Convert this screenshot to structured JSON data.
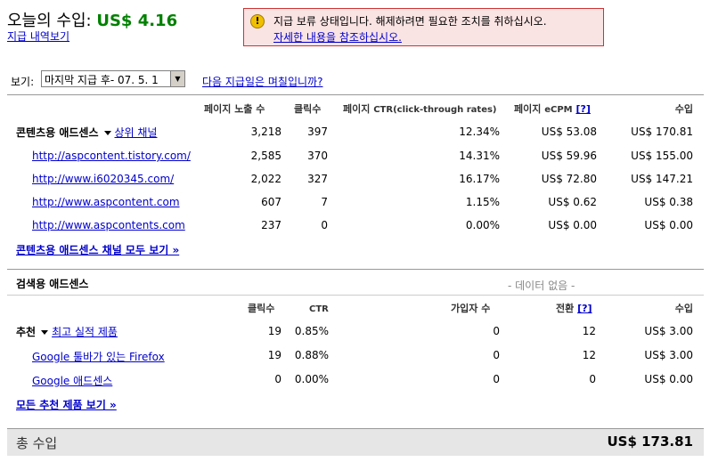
{
  "header": {
    "today_label": "오늘의 수입:",
    "today_amount": "US$ 4.16",
    "history_link": "지급 내역보기"
  },
  "warning": {
    "icon": "exclamation-icon",
    "text": "지급 보류 상태입니다. 해제하려면 필요한 조치를 취하십시오.",
    "link": "자세한 내용을 참조하십시오."
  },
  "view": {
    "label": "보기:",
    "selected": "마지막 지급 후- 07. 5. 1",
    "next_payment_link": "다음 지급일은 며칠입니까?"
  },
  "content_headers": {
    "impressions": "페이지 노출 수",
    "clicks": "클릭수",
    "ctr_prefix": "페이지",
    "ctr_suffix": "CTR(click-through rates)",
    "ecpm_prefix": "페이지",
    "ecpm_suffix": "eCPM",
    "help": "[?]",
    "earnings": "수입"
  },
  "content": {
    "label": "콘텐츠용 애드센스",
    "channel_link": "상위 채널",
    "total": {
      "impressions": "3,218",
      "clicks": "397",
      "ctr": "12.34%",
      "ecpm": "US$ 53.08",
      "earnings": "US$ 170.81"
    },
    "rows": [
      {
        "url": "http://aspcontent.tistory.com/",
        "impressions": "2,585",
        "clicks": "370",
        "ctr": "14.31%",
        "ecpm": "US$ 59.96",
        "earnings": "US$ 155.00"
      },
      {
        "url": "http://www.i6020345.com/",
        "impressions": "2,022",
        "clicks": "327",
        "ctr": "16.17%",
        "ecpm": "US$ 72.80",
        "earnings": "US$ 147.21"
      },
      {
        "url": "http://www.aspcontent.com",
        "impressions": "607",
        "clicks": "7",
        "ctr": "1.15%",
        "ecpm": "US$ 0.62",
        "earnings": "US$ 0.38"
      },
      {
        "url": "http://www.aspcontents.com",
        "impressions": "237",
        "clicks": "0",
        "ctr": "0.00%",
        "ecpm": "US$ 0.00",
        "earnings": "US$ 0.00"
      }
    ],
    "all_channels_link": "콘텐츠용 애드센스 채널 모두 보기 »"
  },
  "search": {
    "label": "검색용 애드센스",
    "no_data": "- 데이터 없음 -"
  },
  "referral_headers": {
    "clicks": "클릭수",
    "ctr": "CTR",
    "signups": "가입자 수",
    "conversions": "전환",
    "help": "[?]",
    "earnings": "수입"
  },
  "referral": {
    "label": "추천",
    "top_link": "최고 실적 제품",
    "total": {
      "clicks": "19",
      "ctr": "0.85%",
      "signups": "0",
      "conversions": "12",
      "earnings": "US$ 3.00"
    },
    "rows": [
      {
        "name": "Google 툴바가 있는 Firefox",
        "clicks": "19",
        "ctr": "0.88%",
        "signups": "0",
        "conversions": "12",
        "earnings": "US$ 3.00"
      },
      {
        "name": "Google 애드센스",
        "clicks": "0",
        "ctr": "0.00%",
        "signups": "0",
        "conversions": "0",
        "earnings": "US$ 0.00"
      }
    ],
    "all_products_link": "모든 추천 제품 보기 »"
  },
  "total": {
    "label": "총 수입",
    "value": "US$ 173.81"
  }
}
